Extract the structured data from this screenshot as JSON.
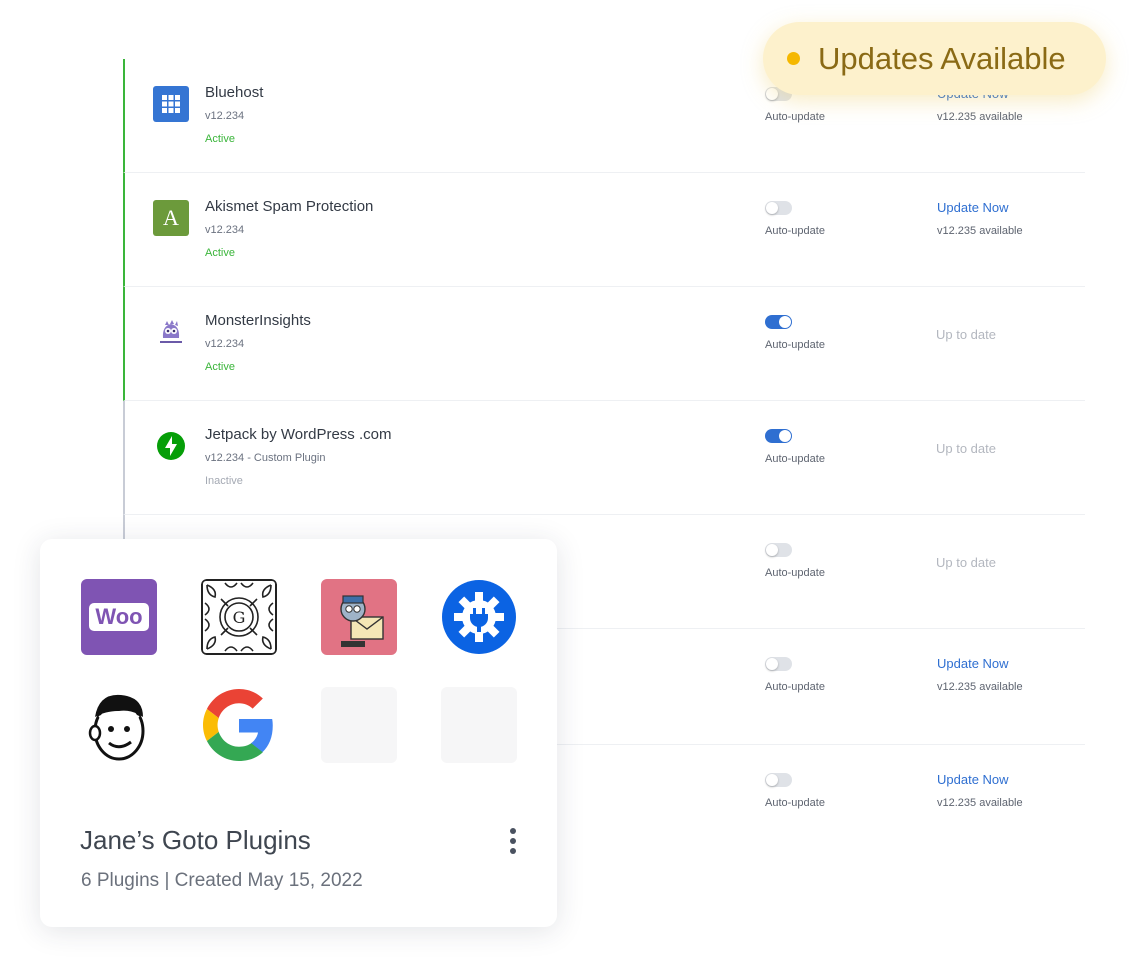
{
  "badge": {
    "text": "Updates Available",
    "dot_color": "#f5b800"
  },
  "plugins": [
    {
      "name": "Bluehost",
      "version": "v12.234",
      "status": "Active",
      "auto_update": false,
      "auto_label": "Auto-update",
      "update_text": "Update Now",
      "available": "v12.235 available",
      "icon": "bluehost-grid-icon"
    },
    {
      "name": "Akismet Spam Protection",
      "version": "v12.234",
      "status": "Active",
      "auto_update": false,
      "auto_label": "Auto-update",
      "update_text": "Update Now",
      "available": "v12.235 available",
      "icon": "akismet-a-icon"
    },
    {
      "name": "MonsterInsights",
      "version": "v12.234",
      "status": "Active",
      "auto_update": true,
      "auto_label": "Auto-update",
      "uptodate": "Up to date",
      "icon": "monsterinsights-icon"
    },
    {
      "name": "Jetpack by WordPress .com",
      "version": "v12.234 - Custom Plugin",
      "status": "Inactive",
      "auto_update": true,
      "auto_label": "Auto-update",
      "uptodate": "Up to date",
      "icon": "jetpack-bolt-icon"
    },
    {
      "auto_update": false,
      "auto_label": "Auto-update",
      "uptodate": "Up to date"
    },
    {
      "auto_update": false,
      "auto_label": "Auto-update",
      "update_text": "Update Now",
      "available": "v12.235 available"
    },
    {
      "auto_update": false,
      "auto_label": "Auto-update",
      "update_text": "Update Now",
      "available": "v12.235 available"
    }
  ],
  "card": {
    "title": "Jane’s Goto Plugins",
    "meta": "6 Plugins | Created May 15, 2022",
    "tiles": [
      "woocommerce-icon",
      "gutenberg-icon",
      "optinmonster-mail-icon",
      "plugin-gear-icon",
      "mailchimp-icon",
      "google-icon",
      "empty-slot",
      "empty-slot"
    ],
    "woo_label": "Woo",
    "gutenberg_letter": "G",
    "akismet_letter": "A"
  },
  "colors": {
    "accent": "#2f6fd1",
    "active": "#3ab53a",
    "woo": "#7f54b3",
    "gear_blue": "#0b63e3"
  }
}
